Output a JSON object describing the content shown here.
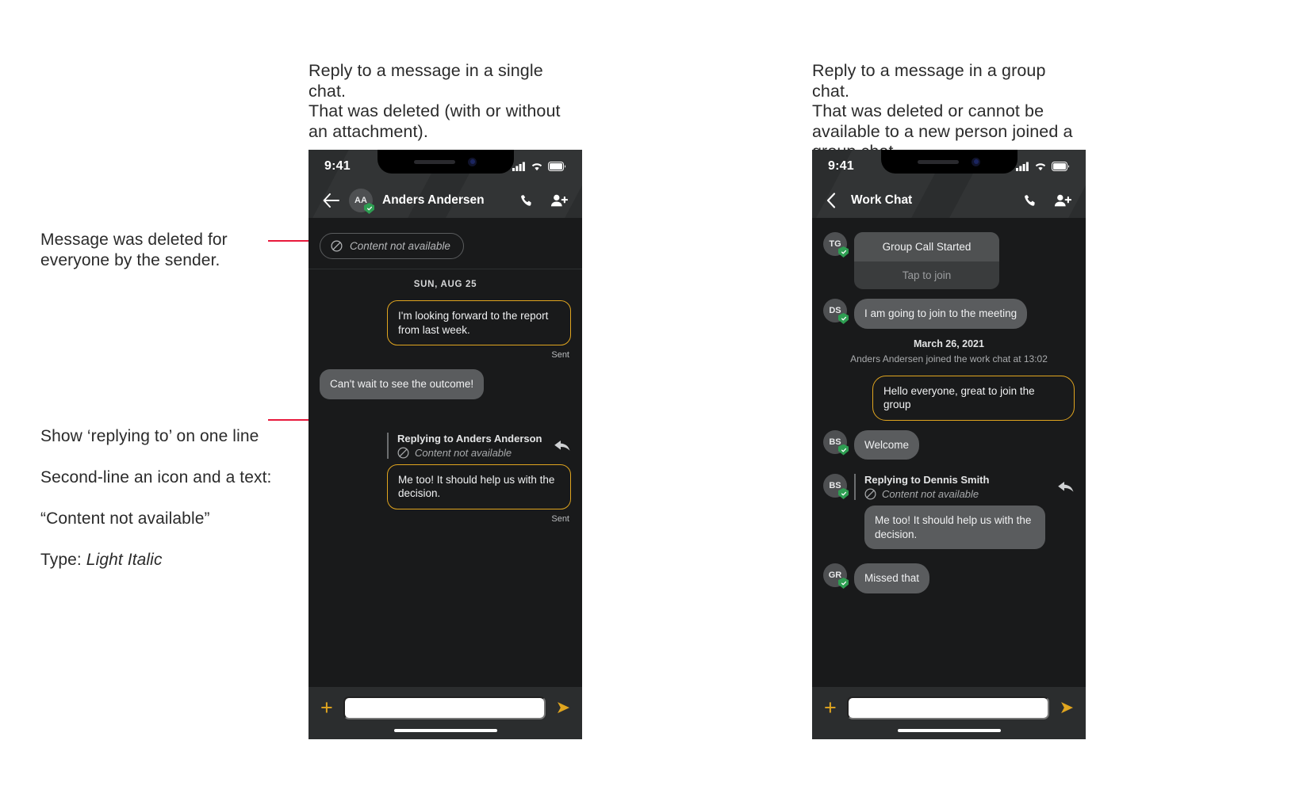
{
  "annotations": {
    "left_heading": "Reply to a message in a single chat.\nThat was deleted (with or without\nan attachment).",
    "right_heading": "Reply to a message in a group chat.\nThat was deleted or cannot be\navailable to a new person joined a\ngroup chat.",
    "note_deleted": "Message was deleted for\neveryone by the sender.",
    "note_replying_line1": "Show ‘replying to’ on one line",
    "note_replying_line2": "Second-line an icon and a text:",
    "note_replying_line3": "“Content not available”",
    "note_type_prefix": "Type: ",
    "note_type_value": "Light Italic",
    "leader_color": "#e8193c"
  },
  "colors": {
    "accent_gold": "#e0a51f",
    "verified_green": "#2e9e52",
    "screen_bg": "#191a1b",
    "header_bg": "#2b2d2e",
    "bubble_in": "#5a5c5e"
  },
  "single_chat": {
    "status": {
      "time": "9:41",
      "signal_icon": "cellular-bars-icon",
      "wifi_icon": "wifi-icon",
      "battery_icon": "battery-icon"
    },
    "nav": {
      "back_icon": "arrow-left-icon",
      "avatar_initials": "AA",
      "title": "Anders Andersen",
      "call_icon": "phone-icon",
      "add_person_icon": "person-add-icon"
    },
    "deleted_pill": {
      "icon": "no-entry-icon",
      "text": "Content not available"
    },
    "day_divider": "SUN, AUG 25",
    "messages": [
      {
        "type": "outgoing",
        "text": "I'm looking forward to the report from last week.",
        "status": "Sent"
      },
      {
        "type": "incoming",
        "text": "Can't wait to see the outcome!"
      }
    ],
    "reply": {
      "quote_name": "Replying to Anders Anderson",
      "quote_icon": "no-entry-icon",
      "quote_text": "Content not available",
      "reply_icon": "reply-arrow-icon",
      "body": "Me too! It should help us with the decision.",
      "status": "Sent"
    },
    "composer": {
      "add_icon": "plus-icon",
      "input_value": "",
      "send_icon": "send-icon"
    }
  },
  "group_chat": {
    "status": {
      "time": "9:41",
      "signal_icon": "cellular-bars-icon",
      "wifi_icon": "wifi-icon",
      "battery_icon": "battery-icon"
    },
    "nav": {
      "back_icon": "chevron-left-icon",
      "title": "Work Chat",
      "call_icon": "phone-icon",
      "add_person_icon": "person-add-icon"
    },
    "call_card": {
      "avatar_initials": "TG",
      "title": "Group Call Started",
      "action": "Tap to join"
    },
    "messages": [
      {
        "type": "incoming",
        "avatar": "DS",
        "text": "I am going to join to the meeting"
      }
    ],
    "date_divider": "March 26, 2021",
    "system_note": "Anders Andersen joined the work chat at 13:02",
    "outgoing": {
      "text": "Hello everyone, great to join the group"
    },
    "welcome": {
      "avatar": "BS",
      "text": "Welcome"
    },
    "reply": {
      "avatar": "BS",
      "quote_name": "Replying to Dennis Smith",
      "quote_icon": "no-entry-icon",
      "quote_text": "Content not available",
      "reply_icon": "reply-arrow-icon",
      "body": "Me too! It should help us with the decision."
    },
    "missed": {
      "avatar": "GR",
      "text": "Missed that"
    },
    "composer": {
      "add_icon": "plus-icon",
      "input_value": "",
      "send_icon": "send-icon"
    }
  }
}
